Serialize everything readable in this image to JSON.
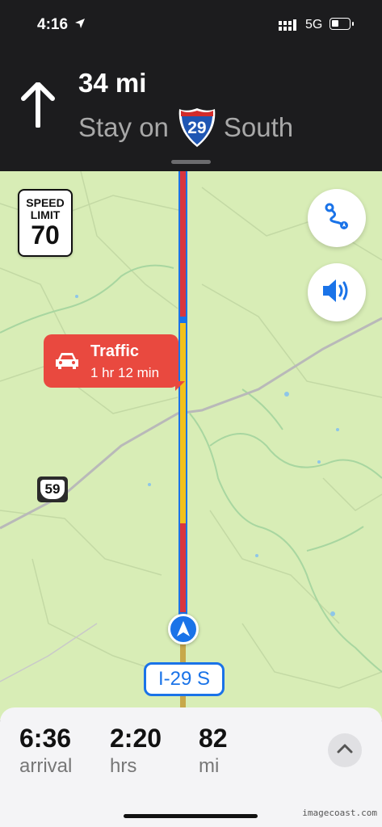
{
  "status_bar": {
    "time": "4:16",
    "network": "5G",
    "battery_level": 0.35
  },
  "navigation": {
    "distance": "34 mi",
    "instruction_prefix": "Stay on",
    "route_shield": "29",
    "instruction_suffix": "South"
  },
  "map": {
    "speed_limit": {
      "line1": "SPEED",
      "line2": "LIMIT",
      "value": "70"
    },
    "traffic_callout": {
      "title": "Traffic",
      "delay": "1 hr 12 min"
    },
    "highway_marker": "59",
    "road_label": "I-29 S",
    "route_colors": {
      "route_blue": "#1a73e8",
      "heavy_traffic": "#d9363e",
      "moderate_traffic": "#f3c11b"
    }
  },
  "trip": {
    "arrival_value": "6:36",
    "arrival_label": "arrival",
    "duration_value": "2:20",
    "duration_label": "hrs",
    "distance_value": "82",
    "distance_label": "mi"
  },
  "icons": [
    "location-arrow-icon",
    "signal-icon",
    "battery-icon",
    "straight-arrow-icon",
    "interstate-shield-icon",
    "route-overview-icon",
    "speaker-icon",
    "car-icon",
    "user-location-icon",
    "chevron-up-icon"
  ],
  "watermark": "imagecoast.com"
}
